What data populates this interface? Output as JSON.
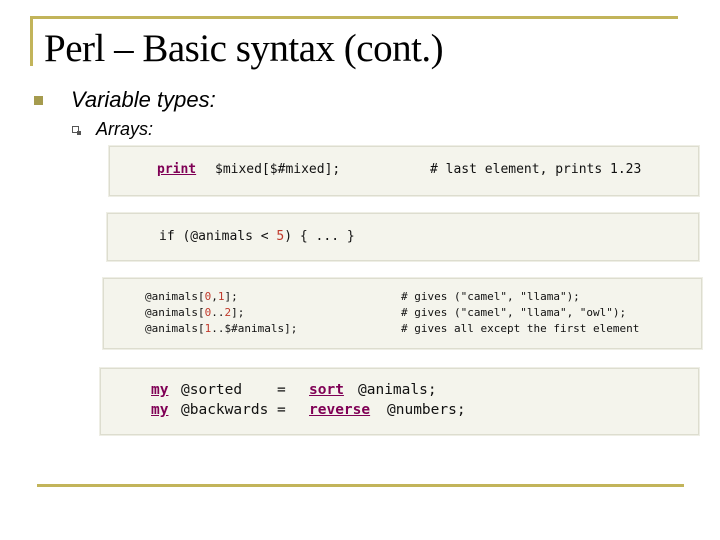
{
  "slide": {
    "title": "Perl – Basic syntax (cont.)",
    "bullet1": "Variable types:",
    "bullet2": "Arrays:"
  },
  "code1": {
    "kw": "print",
    "expr": "$mixed[$#mixed];",
    "comment": "# last element, prints 1.23"
  },
  "code2": {
    "pre": "if (@animals < ",
    "num": "5",
    "post": ") { ... }"
  },
  "code3": {
    "lines": [
      {
        "a": "@animals[",
        "n1": "0",
        "b": ",",
        "n2": "1",
        "c": "];",
        "comment": "# gives (\"camel\", \"llama\");"
      },
      {
        "a": "@animals[",
        "n1": "0",
        "b": "..",
        "n2": "2",
        "c": "];",
        "comment": "# gives (\"camel\", \"llama\", \"owl\");"
      },
      {
        "a": "@animals[",
        "n1": "1",
        "b": "..$#animals];",
        "n2": "",
        "c": "",
        "comment": "# gives all except the first element"
      }
    ]
  },
  "code4": {
    "lines": [
      {
        "kw1": "my",
        "var": "@sorted    =",
        "kw2": "sort",
        "rest": "@animals;"
      },
      {
        "kw1": "my",
        "var": "@backwards =",
        "kw2": "reverse",
        "rest": "@numbers;"
      }
    ]
  }
}
